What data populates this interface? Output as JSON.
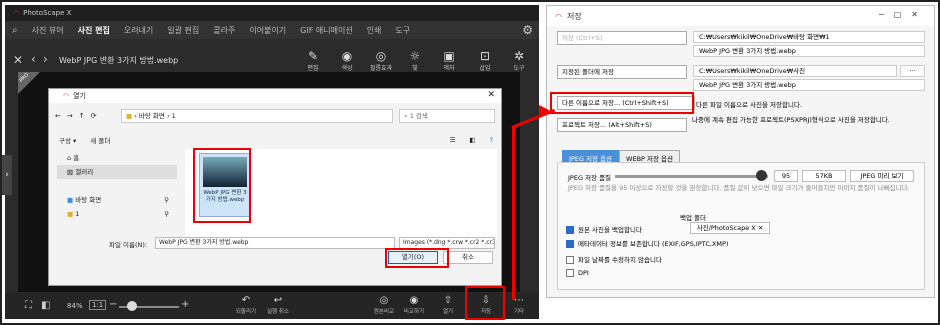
{
  "photoscape": {
    "title": "PhotoScape X",
    "menu": [
      "사진 뷰어",
      "사진 편집",
      "오려내기",
      "일괄 편집",
      "콜라주",
      "이어붙이기",
      "GIF 애니메이션",
      "인쇄",
      "도구"
    ],
    "active_menu": "사진 편집",
    "filename": "WebP JPG 변환 3가지 방법.webp",
    "toolbar": [
      "편집",
      "색상",
      "필름효과",
      "빛",
      "액자",
      "삽입",
      "도구"
    ],
    "pro_badge": "PRO",
    "zoom": "84%",
    "ratio_label": "1:1",
    "bottom_buttons": [
      "되돌리기",
      "실행 취소",
      "원본비교",
      "비교하기",
      "열기",
      "저장",
      "기타"
    ],
    "minus": "−",
    "plus": "+"
  },
  "open_dialog": {
    "title": "열기",
    "address": "› 바탕 화면 › 1",
    "search_placeholder": "1 검색",
    "organize": "구성 ▾",
    "new_folder": "새 폴더",
    "nav_items": [
      "홈",
      "갤러리",
      "바탕 화면",
      "1"
    ],
    "file_label": "WebP JPG 변환 3가지 방법.webp",
    "filename_label": "파일 이름(N):",
    "filename_value": "WebP JPG 변환 3가지 방법.webp",
    "filetype": "Images (*.dng *.crw *.cr2 *.cr3",
    "open_btn": "열기(O)",
    "cancel_btn": "취소"
  },
  "save_panel": {
    "title": "저장",
    "save_label": "저장 (Ctrl+S)",
    "path1": "C:₩Users₩kikil₩OneDrive₩바탕 화면₩1",
    "file1": "WebP JPG 변환 3가지 방법.webp",
    "save_to_folder": "지정된 폴더에 저장",
    "path2": "C:₩Users₩kikil₩OneDrive₩사진",
    "browse": "···",
    "file2": "WebP JPG 변환 3가지 방법.webp",
    "save_as": "다른 이름으로 저장... (Ctrl+Shift+S)",
    "save_as_desc": "다른 파일 이름으로 사진을 저장합니다.",
    "project_save": "프로젝트 저장... (Alt+Shift+S)",
    "project_desc": "나중에 계속 편집 가능한 프로젝트(PSXPRJ)형식으로 사진을 저장합니다.",
    "tab_jpeg": "JPEG 저장 옵션",
    "tab_webp": "WEBP 저장 옵션",
    "quality_label": "JPEG 저장 품질",
    "quality_value": "95",
    "filesize": "57KB",
    "preview_btn": "JPEG 미리 보기",
    "quality_desc": "JPEG 저장 품질을 95 이상으로 지정할 것을 권장합니다. 품질 값이 낮으면 파일 크기가 줄어들지만 이미지 품질이 나빠집니다.",
    "backup_folder_label": "백업 폴더",
    "backup_folder": "사진/PhotoScape X",
    "opt_backup": "원본 사진을 백업합니다",
    "opt_metadata": "메타데이터 정보를 보존합니다 (EXIF,GPS,IPTC,XMP)",
    "opt_keepdate": "파일 날짜를 수정하지 않습니다",
    "opt_dpi": "DPI"
  }
}
